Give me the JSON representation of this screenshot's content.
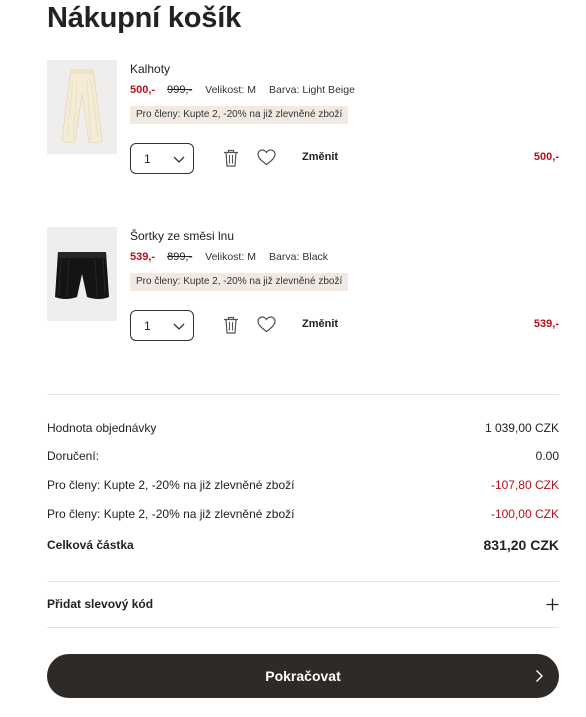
{
  "page": {
    "title": "Nákupní košík"
  },
  "items": [
    {
      "name": "Kalhoty",
      "price": "500,-",
      "old_price": "999,-",
      "size_label": "Velikost:",
      "size": "M",
      "color_label": "Barva:",
      "color": "Light Beige",
      "promo": "Pro členy: Kupte 2, -20% na již zlevněné zboží",
      "qty": "1",
      "change_label": "Změnit",
      "total": "500,-",
      "image_icon": "beige-trousers-image"
    },
    {
      "name": "Šortky ze směsi lnu",
      "price": "539,-",
      "old_price": "899,-",
      "size_label": "Velikost:",
      "size": "M",
      "color_label": "Barva:",
      "color": "Black",
      "promo": "Pro členy: Kupte 2, -20% na již zlevněné zboží",
      "qty": "1",
      "change_label": "Změnit",
      "total": "539,-",
      "image_icon": "black-shorts-image"
    }
  ],
  "summary": {
    "order_value_label": "Hodnota objednávky",
    "order_value": "1 039,00 CZK",
    "delivery_label": "Doručení:",
    "delivery": "0.00",
    "discount1_label": "Pro členy: Kupte 2, -20% na již zlevněné zboží",
    "discount1": "-107,80 CZK",
    "discount2_label": "Pro členy: Kupte 2, -20% na již zlevněné zboží",
    "discount2": "-100,00 CZK",
    "total_label": "Celková částka",
    "total": "831,20 CZK"
  },
  "discount_code": {
    "label": "Přidat slevový kód"
  },
  "cta": {
    "label": "Pokračovat"
  },
  "colors": {
    "sale_red": "#b5121b",
    "promo_bg": "#f2eae2",
    "button_bg": "#2e2a27"
  }
}
